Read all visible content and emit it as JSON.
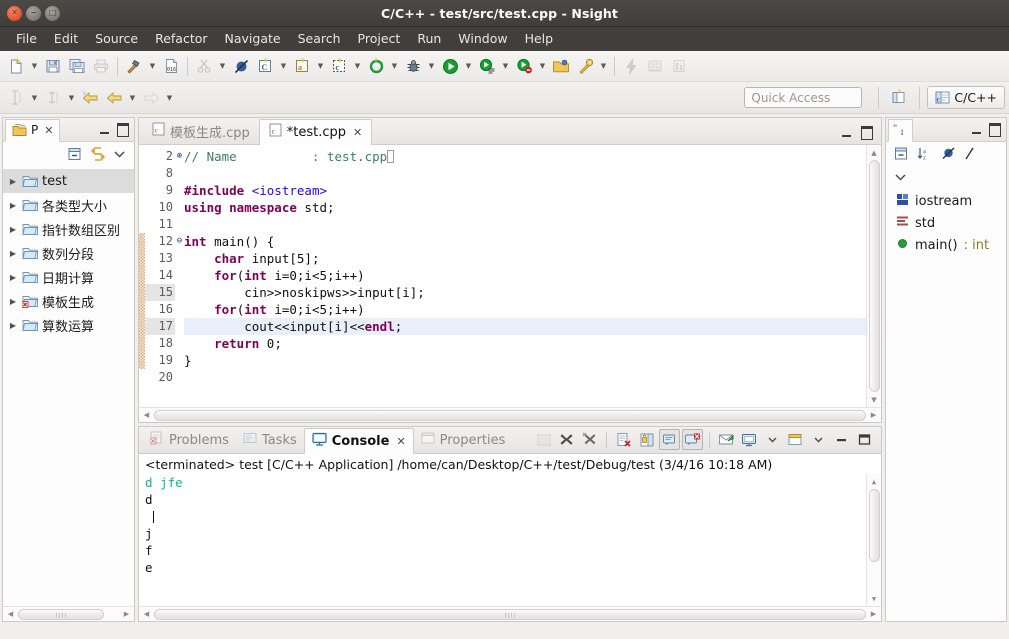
{
  "window": {
    "title": "C/C++ - test/src/test.cpp - Nsight",
    "buttons": {
      "close": "close-button",
      "minimize": "minimize-button",
      "maximize": "maximize-button"
    }
  },
  "menubar": {
    "items": [
      {
        "label": "File"
      },
      {
        "label": "Edit"
      },
      {
        "label": "Source"
      },
      {
        "label": "Refactor"
      },
      {
        "label": "Navigate"
      },
      {
        "label": "Search"
      },
      {
        "label": "Project"
      },
      {
        "label": "Run"
      },
      {
        "label": "Window"
      },
      {
        "label": "Help"
      }
    ]
  },
  "toolbar": {
    "quick_access_placeholder": "Quick Access",
    "perspective_label": "C/C++"
  },
  "project_explorer": {
    "tab_label": "P",
    "items": [
      {
        "label": "test",
        "selected": true,
        "error": false
      },
      {
        "label": "各类型大小",
        "selected": false,
        "error": false
      },
      {
        "label": "指针数组区别",
        "selected": false,
        "error": false
      },
      {
        "label": "数列分段",
        "selected": false,
        "error": false
      },
      {
        "label": "日期计算",
        "selected": false,
        "error": false
      },
      {
        "label": "模板生成",
        "selected": false,
        "error": true
      },
      {
        "label": "算数运算",
        "selected": false,
        "error": false
      }
    ]
  },
  "editor": {
    "tabs": [
      {
        "label": "模板生成.cpp",
        "active": false,
        "dirty": false
      },
      {
        "label": "*test.cpp",
        "active": true,
        "dirty": true
      }
    ],
    "lines": [
      {
        "num": "2",
        "fold": "+",
        "changed": false,
        "current": false,
        "numhl": false,
        "tokens": [
          {
            "t": "// Name          : test.cpp",
            "c": "cmt"
          },
          {
            "t": "\u0000CARET",
            "c": "caret"
          }
        ]
      },
      {
        "num": "8",
        "fold": "",
        "changed": false,
        "current": false,
        "numhl": false,
        "tokens": []
      },
      {
        "num": "9",
        "fold": "",
        "changed": false,
        "current": false,
        "numhl": false,
        "tokens": [
          {
            "t": "#include ",
            "c": "kw"
          },
          {
            "t": "<iostream>",
            "c": "inc"
          }
        ]
      },
      {
        "num": "10",
        "fold": "",
        "changed": false,
        "current": false,
        "numhl": false,
        "tokens": [
          {
            "t": "using namespace ",
            "c": "kw"
          },
          {
            "t": "std;",
            "c": "plain"
          }
        ]
      },
      {
        "num": "11",
        "fold": "",
        "changed": false,
        "current": false,
        "numhl": false,
        "tokens": []
      },
      {
        "num": "12",
        "fold": "-",
        "changed": true,
        "current": false,
        "numhl": false,
        "tokens": [
          {
            "t": "int ",
            "c": "kw"
          },
          {
            "t": "main() {",
            "c": "plain"
          }
        ]
      },
      {
        "num": "13",
        "fold": "",
        "changed": true,
        "current": false,
        "numhl": false,
        "tokens": [
          {
            "t": "    char ",
            "c": "kw"
          },
          {
            "t": "input[5];",
            "c": "plain"
          }
        ]
      },
      {
        "num": "14",
        "fold": "",
        "changed": true,
        "current": false,
        "numhl": false,
        "tokens": [
          {
            "t": "    for",
            "c": "kw"
          },
          {
            "t": "(",
            "c": "plain"
          },
          {
            "t": "int ",
            "c": "kw"
          },
          {
            "t": "i=0;i<5;i++)",
            "c": "plain"
          }
        ]
      },
      {
        "num": "15",
        "fold": "",
        "changed": true,
        "current": false,
        "numhl": true,
        "tokens": [
          {
            "t": "        cin>>noskipws>>input[i];",
            "c": "plain"
          }
        ]
      },
      {
        "num": "16",
        "fold": "",
        "changed": true,
        "current": false,
        "numhl": false,
        "tokens": [
          {
            "t": "    for",
            "c": "kw"
          },
          {
            "t": "(",
            "c": "plain"
          },
          {
            "t": "int ",
            "c": "kw"
          },
          {
            "t": "i=0;i<5;i++)",
            "c": "plain"
          }
        ]
      },
      {
        "num": "17",
        "fold": "",
        "changed": true,
        "current": true,
        "numhl": true,
        "tokens": [
          {
            "t": "        cout<<input[i]<<",
            "c": "plain"
          },
          {
            "t": "endl",
            "c": "kw"
          },
          {
            "t": ";",
            "c": "plain"
          }
        ]
      },
      {
        "num": "18",
        "fold": "",
        "changed": true,
        "current": false,
        "numhl": false,
        "tokens": [
          {
            "t": "    return ",
            "c": "kw"
          },
          {
            "t": "0;",
            "c": "plain"
          }
        ]
      },
      {
        "num": "19",
        "fold": "",
        "changed": true,
        "current": false,
        "numhl": false,
        "tokens": [
          {
            "t": "}",
            "c": "plain"
          }
        ]
      },
      {
        "num": "20",
        "fold": "",
        "changed": false,
        "current": false,
        "numhl": false,
        "tokens": []
      }
    ]
  },
  "outline": {
    "items": [
      {
        "label": "iostream",
        "icon": "include-icon",
        "type": ""
      },
      {
        "label": "std",
        "icon": "namespace-icon",
        "type": ""
      },
      {
        "label": "main()",
        "icon": "function-icon",
        "type": " : int"
      }
    ]
  },
  "bottom_panel": {
    "tabs": [
      {
        "label": "Problems",
        "active": false
      },
      {
        "label": "Tasks",
        "active": false
      },
      {
        "label": "Console",
        "active": true
      },
      {
        "label": "Properties",
        "active": false
      }
    ],
    "console": {
      "header": "<terminated> test [C/C++ Application] /home/can/Desktop/C++/test/Debug/test (3/4/16 10:18 AM)",
      "lines": [
        {
          "text": "d jfe",
          "kind": "input"
        },
        {
          "text": "d",
          "kind": "out"
        },
        {
          "text": " ",
          "kind": "caret"
        },
        {
          "text": "j",
          "kind": "out"
        },
        {
          "text": "f",
          "kind": "out"
        },
        {
          "text": "e",
          "kind": "out"
        }
      ]
    }
  },
  "colors": {
    "titlebar": "#413f3c",
    "accent_keyword": "#7f0055",
    "accent_string": "#2a00ff",
    "accent_comment": "#3f7f5f",
    "console_input": "#15b583",
    "change_bar": "#e8a97a",
    "selection": "#dcdcdc",
    "current_line": "#e8eefa"
  }
}
